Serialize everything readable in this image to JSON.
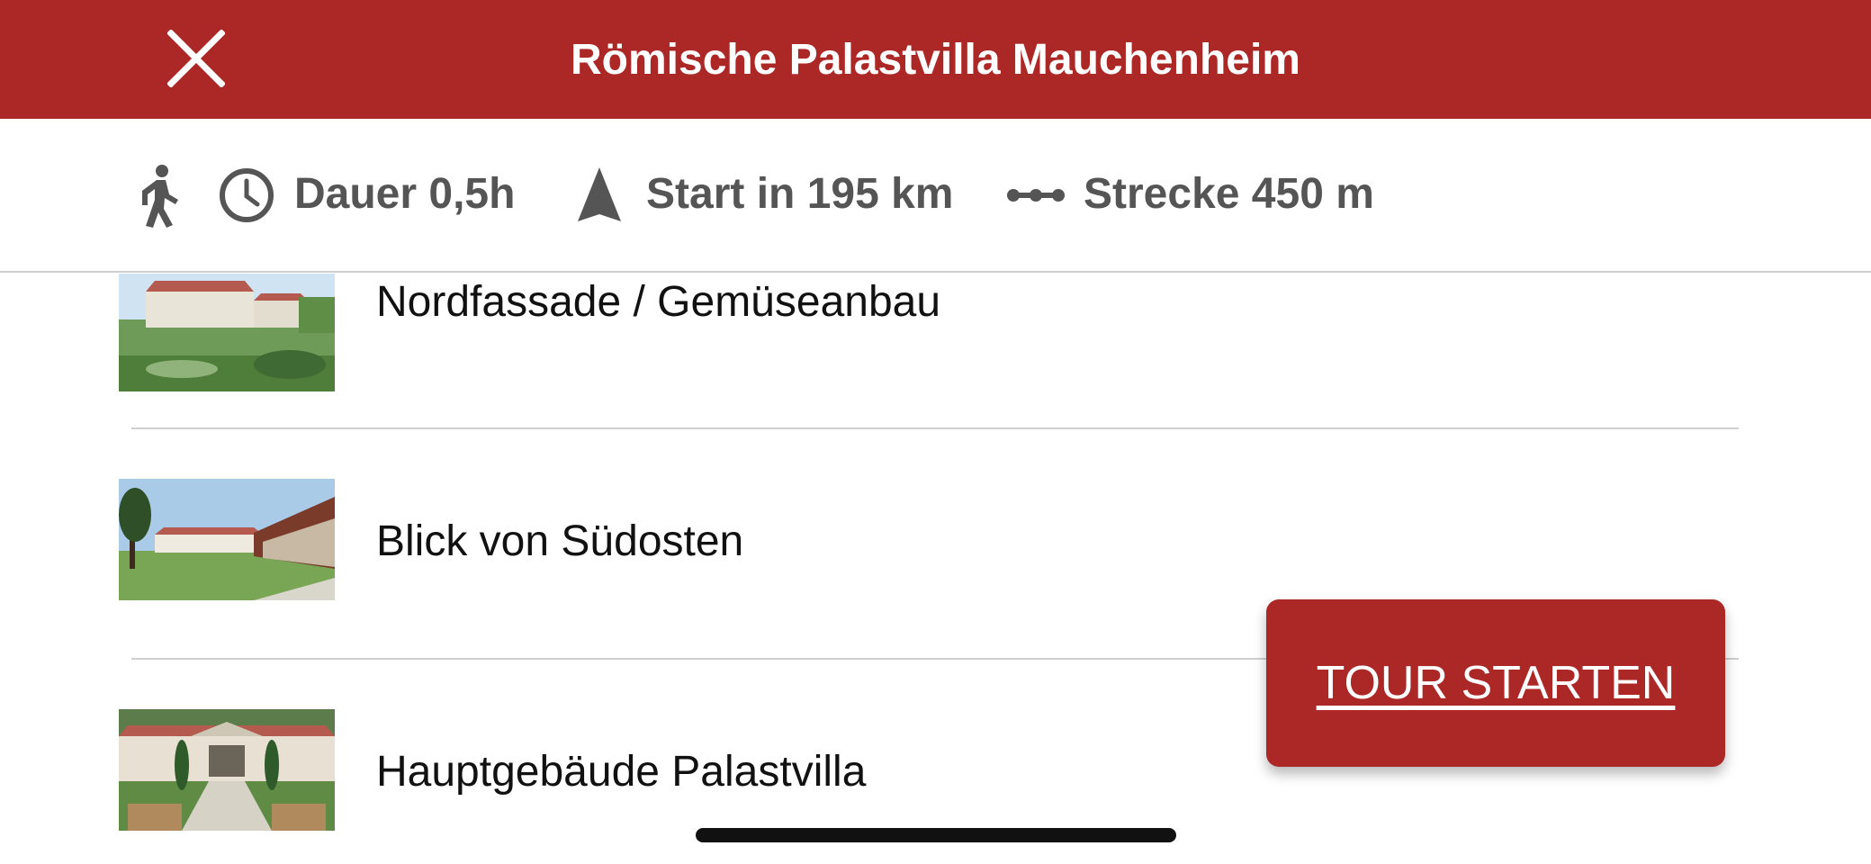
{
  "header": {
    "title": "Römische Palastvilla Mauchenheim",
    "close_icon": "close-icon",
    "background": "#ac2826"
  },
  "info": {
    "walk_icon": "walking-person-icon",
    "duration_icon": "clock-icon",
    "duration": "Dauer 0,5h",
    "start_icon": "navigation-arrow-icon",
    "start": "Start in 195 km",
    "route_icon": "route-dots-icon",
    "route": "Strecke 450 m"
  },
  "stations": [
    {
      "label": "Nordfassade / Gemüseanbau",
      "thumbnail": "garden-vegetable-beds-image"
    },
    {
      "label": "Blick von Südosten",
      "thumbnail": "villa-southeast-view-image"
    },
    {
      "label": "Hauptgebäude Palastvilla",
      "thumbnail": "main-building-image"
    }
  ],
  "cta": {
    "label": "TOUR STARTEN"
  }
}
